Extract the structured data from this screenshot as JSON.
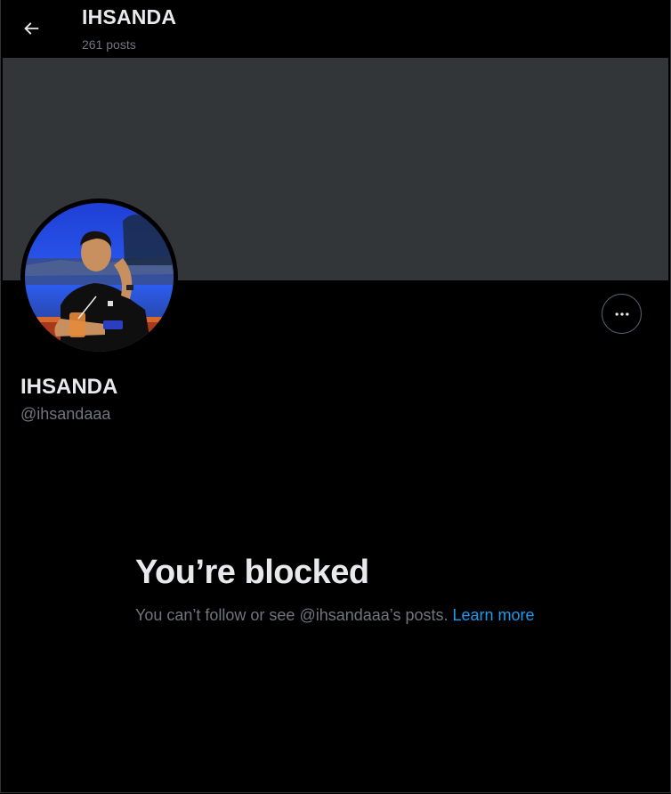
{
  "header": {
    "title": "IHSANDA",
    "post_count": "261 posts",
    "back_icon": "arrow-left-icon"
  },
  "profile": {
    "display_name": "IHSANDA",
    "handle": "@ihsandaaa",
    "more_icon": "more-horizontal-icon"
  },
  "blocked": {
    "title": "You’re blocked",
    "message": "You can’t follow or see @ihsandaaa’s posts. ",
    "link_label": "Learn more"
  },
  "colors": {
    "background": "#000000",
    "banner": "#333639",
    "primary_text": "#e7e9ea",
    "secondary_text": "#71767b",
    "link": "#1d9bf0"
  }
}
